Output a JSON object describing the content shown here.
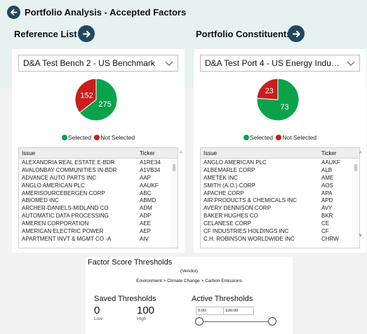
{
  "header": {
    "title": "Portfolio Analysis - Accepted Factors"
  },
  "reference": {
    "title": "Reference List",
    "dropdown": "D&A Test Bench 2 - US Benchmark",
    "selected": 275,
    "not_selected": 152,
    "columns": [
      "Issue",
      "Ticker"
    ],
    "rows": [
      [
        "ALEXANDRIA REAL ESTATE E-BDR",
        "A1RE34"
      ],
      [
        "AVALONBAY COMMUNITIES IN-BDR",
        "A1VB34"
      ],
      [
        "ADVANCE AUTO PARTS INC",
        "AAP"
      ],
      [
        "ANGLO AMERICAN PLC",
        "AAUKF"
      ],
      [
        "AMERISOURCEBERGEN CORP",
        "ABC"
      ],
      [
        "ABIOMED INC",
        "ABMD"
      ],
      [
        "ARCHER-DANIELS-MIDLAND CO",
        "ADM"
      ],
      [
        "AUTOMATIC DATA PROCESSING",
        "ADP"
      ],
      [
        "AMEREN CORPORATION",
        "AEE"
      ],
      [
        "AMERICAN ELECTRIC POWER",
        "AEP"
      ],
      [
        "APARTMENT INVT & MGMT CO -A",
        "AIV"
      ]
    ]
  },
  "portfolio": {
    "title": "Portfolio Constituents",
    "dropdown": "D&A Test Port 4 - US Energy Industrials M...",
    "selected": 73,
    "not_selected": 23,
    "columns": [
      "Issue",
      "Ticker"
    ],
    "rows": [
      [
        "ANGLO AMERICAN PLC",
        "AAUKF"
      ],
      [
        "ALBEMARLE CORP",
        "ALB"
      ],
      [
        "AMETEK INC",
        "AME"
      ],
      [
        "SMITH (A.O.) CORP",
        "AOS"
      ],
      [
        "APACHE CORP",
        "APA"
      ],
      [
        "AIR PRODUCTS & CHEMICALS INC",
        "APD"
      ],
      [
        "AVERY DENNISON CORP",
        "AVY"
      ],
      [
        "BAKER HUGHES CO",
        "BKR"
      ],
      [
        "CELANESE CORP",
        "CE"
      ],
      [
        "CF INDUSTRIES HOLDINGS INC",
        "CF"
      ],
      [
        "C.H. ROBINSON WORLDWIDE INC",
        "CHRW"
      ]
    ]
  },
  "legend": {
    "selected": "Selected",
    "not_selected": "Not Selected"
  },
  "colors": {
    "selected": "#0aa34b",
    "not_selected": "#c81e1e",
    "accent": "#1f4a5e"
  },
  "thresholds": {
    "title": "Factor Score Thresholds",
    "vendor": "(Vendor)",
    "breadcrumb": "Environment > Climate Change > Carbon Emissions",
    "saved_title": "Saved Thresholds",
    "saved_low": "0",
    "saved_low_label": "Low",
    "saved_high": "100",
    "saved_high_label": "High",
    "active_title": "Active Thresholds",
    "active_low": "0.00",
    "active_high": "100.00"
  }
}
